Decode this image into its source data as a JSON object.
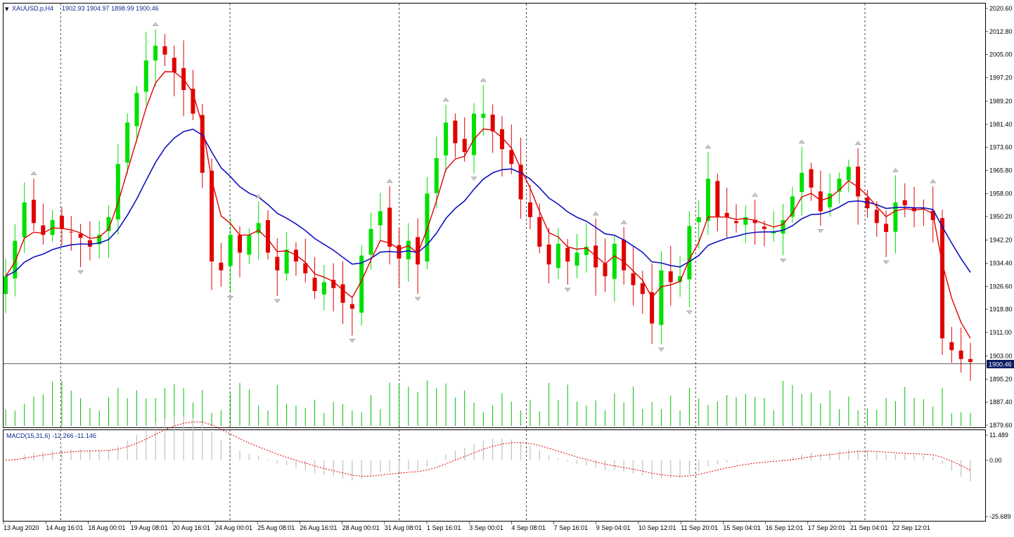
{
  "header": {
    "symbol_label": "XAUUSD,p,H4",
    "ohlc": "1902.93 1904.97 1898.99 1900.46",
    "macd_label": "MACD(15,31,6) -12.266 -11.146"
  },
  "colors": {
    "bull": "#00e000",
    "bear": "#e00000",
    "ma_fast": "#e00000",
    "ma_slow": "#1010c0",
    "volume": "#00c000",
    "macd_hist": "#c0c0c0",
    "macd_signal": "#e00000",
    "grid": "#000000",
    "price_tag_bg": "#0b1e63"
  },
  "chart_data": [
    {
      "type": "candlestick",
      "name": "XAUUSD,p,H4",
      "y_ticks": [
        "2020.60",
        "2012.80",
        "2005.00",
        "1997.20",
        "1989.20",
        "1981.40",
        "1973.60",
        "1965.80",
        "1958.00",
        "1950.20",
        "1942.20",
        "1934.40",
        "1926.60",
        "1918.80",
        "1911.00",
        "1903.00",
        "1895.20",
        "1887.40",
        "1879.60"
      ],
      "y_range": [
        1879.6,
        2020.6
      ],
      "last_price": "1900.46",
      "x_ticks": [
        "13 Aug 2020",
        "14 Aug 16:01",
        "18 Aug 00:01",
        "19 Aug 08:01",
        "20 Aug 16:01",
        "24 Aug 00:01",
        "25 Aug 08:01",
        "26 Aug 16:01",
        "28 Aug 00:01",
        "31 Aug 08:01",
        "1 Sep 16:01",
        "3 Sep 00:01",
        "4 Sep 08:01",
        "7 Sep 16:01",
        "9 Sep 04:01",
        "10 Sep 12:01",
        "11 Sep 20:01",
        "15 Sep 04:01",
        "16 Sep 12:01",
        "17 Sep 20:01",
        "21 Sep 04:01",
        "22 Sep 12:01"
      ],
      "period_separators": [
        "14 Aug 16:01",
        "24 Aug 00:01",
        "31 Aug 08:01",
        "4 Sep 08:01",
        "11 Sep 20:01",
        "21 Sep 04:01"
      ],
      "close_path": [
        1930,
        1942,
        1955,
        1948,
        1944,
        1949,
        1946,
        1945,
        1943,
        1940,
        1944,
        1950,
        1968,
        1982,
        1992,
        2003,
        2008,
        2005,
        1999,
        1993,
        1985,
        1965,
        1935,
        1932,
        1944,
        1938,
        1944,
        1948,
        1938,
        1932,
        1939,
        1935,
        1931,
        1925,
        1928,
        1926,
        1921,
        1919,
        1937,
        1946,
        1952,
        1940,
        1936,
        1942,
        1934,
        1958,
        1970,
        1982,
        1975,
        1972,
        1985,
        1985,
        1979,
        1973,
        1968,
        1956,
        1950,
        1940,
        1934,
        1941,
        1935,
        1938,
        1940,
        1933,
        1930,
        1941,
        1932,
        1927,
        1924,
        1914,
        1932,
        1928,
        1930,
        1947,
        1950,
        1963,
        1950,
        1950,
        1948,
        1950,
        1948,
        1946,
        1945,
        1949,
        1957,
        1965,
        1960,
        1952,
        1958,
        1963,
        1967,
        1957,
        1953,
        1948,
        1945,
        1955,
        1954,
        1952,
        1953,
        1949,
        1909,
        1905,
        1902,
        1901
      ]
    },
    {
      "type": "bar",
      "name": "volume",
      "note": "tick volume bars along bottom of price panel"
    },
    {
      "type": "bar",
      "name": "MACD(15,31,6)",
      "y_ticks": [
        "11.489",
        "0.00",
        "-25.689"
      ],
      "y_range": [
        -25.689,
        11.489
      ],
      "macd": -12.266,
      "signal": -11.146
    }
  ]
}
